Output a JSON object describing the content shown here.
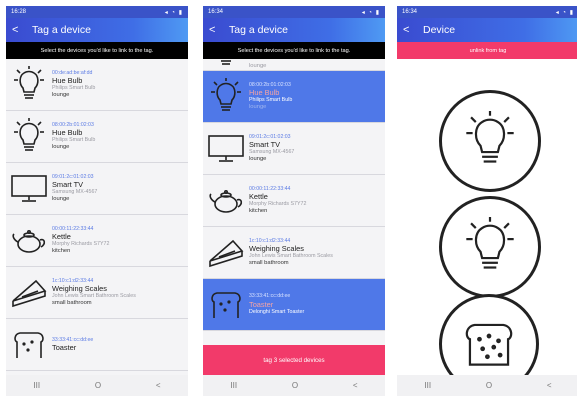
{
  "screens": [
    {
      "status_time": "16:28",
      "status_icons": "signal-wifi-battery-icons",
      "title": "Tag a device",
      "banner": "Select the devices you'd like to link to the tag.",
      "devices": [
        {
          "mac": "00:de:ad:be:af:dd",
          "name": "Hue Bulb",
          "model": "Philips Smart Bulb",
          "location": "lounge",
          "icon": "bulb-icon"
        },
        {
          "mac": "08:00:2b:01:02:03",
          "name": "Hue Bulb",
          "model": "Philips Smart Bulb",
          "location": "lounge",
          "icon": "bulb-icon"
        },
        {
          "mac": "09:01:2c:01:02:03",
          "name": "Smart TV",
          "model": "Samsung MX-4567",
          "location": "lounge",
          "icon": "tv-icon"
        },
        {
          "mac": "00:00:11:22:33:44",
          "name": "Kettle",
          "model": "Morphy Richards S7Y72",
          "location": "kitchen",
          "icon": "kettle-icon"
        },
        {
          "mac": "1c:10:c1:d2:33:44",
          "name": "Weighing Scales",
          "model": "John Lewis Smart Bathroom Scales",
          "location": "small bathroom",
          "icon": "scales-icon"
        },
        {
          "mac": "33:33:41:cc:dd:ee",
          "name": "Toaster",
          "model": "",
          "location": "",
          "icon": "toaster-icon"
        }
      ]
    },
    {
      "status_time": "16:34",
      "title": "Tag a device",
      "banner": "Select the devices you'd like to link to the tag.",
      "partial_location": "lounge",
      "devices": [
        {
          "mac": "08:00:2b:01:02:03",
          "name": "Hue Bulb",
          "model": "Philips Smart Bulb",
          "location": "lounge",
          "selected": true
        },
        {
          "mac": "09:01:2c:01:02:03",
          "name": "Smart TV",
          "model": "Samsung MX-4567",
          "location": "lounge",
          "selected": false
        },
        {
          "mac": "00:00:11:22:33:44",
          "name": "Kettle",
          "model": "Morphy Richards S7Y72",
          "location": "kitchen",
          "selected": false
        },
        {
          "mac": "1c:10:c1:d2:33:44",
          "name": "Weighing Scales",
          "model": "John Lewis Smart Bathroom Scales",
          "location": "small bathroom",
          "selected": false
        },
        {
          "mac": "33:33:41:cc:dd:ee",
          "name": "Toaster",
          "model": "Delonghi Smart Toaster",
          "location": "",
          "selected": true
        }
      ],
      "action": "tag 3 selected devices"
    },
    {
      "status_time": "16:34",
      "title": "Device",
      "banner": "unlink from tag"
    }
  ],
  "navbar": {
    "recents": "III",
    "home": "O",
    "back": "<"
  },
  "colors": {
    "accent_blue": "#3a53c8",
    "selected_row": "#4f78e8",
    "pink": "#f23a6a"
  }
}
